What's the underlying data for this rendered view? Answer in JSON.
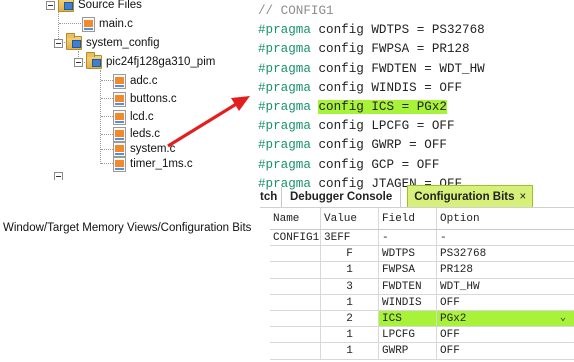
{
  "tree": {
    "source_files": "Source Files",
    "main": "main.c",
    "system_config": "system_config",
    "board": "pic24fj128ga310_pim",
    "adc": "adc.c",
    "buttons": "buttons.c",
    "lcd": "lcd.c",
    "leds": "leds.c",
    "system": "system.c",
    "timer": "timer_1ms.c"
  },
  "code": {
    "comment": "// CONFIG1",
    "lines": [
      {
        "keyword": "#pragma",
        "text": " config WDTPS = PS32768"
      },
      {
        "keyword": "#pragma",
        "text": " config FWPSA = PR128"
      },
      {
        "keyword": "#pragma",
        "text": " config FWDTEN = WDT_HW"
      },
      {
        "keyword": "#pragma",
        "text": " config WINDIS = OFF"
      },
      {
        "keyword": "#pragma",
        "text": "config ICS = PGx2"
      },
      {
        "keyword": "#pragma",
        "text": " config LPCFG = OFF"
      },
      {
        "keyword": "#pragma",
        "text": " config GWRP = OFF"
      },
      {
        "keyword": "#pragma",
        "text": " config GCP = OFF"
      },
      {
        "keyword": "#pragma",
        "text": " config JTAGEN = OFF"
      }
    ]
  },
  "caption": "Window/Target Memory Views/Configuration Bits",
  "panel": {
    "tabs": [
      "tch",
      "Debugger Console",
      "Configuration Bits"
    ],
    "close": "×",
    "columns": [
      "Name",
      "Value",
      "Field",
      "Option"
    ],
    "rows": [
      [
        "CONFIG1",
        "3EFF",
        "-",
        "-"
      ],
      [
        "",
        "F",
        "WDTPS",
        "PS32768"
      ],
      [
        "",
        "1",
        "FWPSA",
        "PR128"
      ],
      [
        "",
        "3",
        "FWDTEN",
        "WDT_HW"
      ],
      [
        "",
        "1",
        "WINDIS",
        "OFF"
      ],
      [
        "",
        "2",
        "ICS",
        "PGx2"
      ],
      [
        "",
        "1",
        "LPCFG",
        "OFF"
      ],
      [
        "",
        "1",
        "GWRP",
        "OFF"
      ]
    ],
    "dropdown_icon": "chevron-down-icon"
  },
  "colors": {
    "highlight": "#a9f23a",
    "pragma_keyword": "#17936a",
    "arrow": "#e41e1e",
    "active_tab": "#d6f07a"
  }
}
